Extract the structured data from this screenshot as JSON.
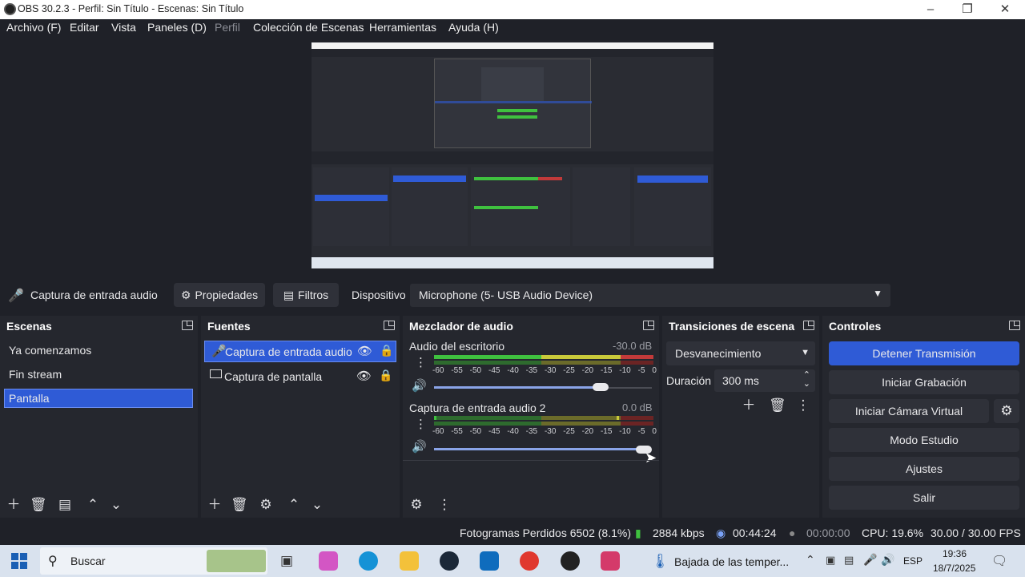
{
  "window": {
    "title": "OBS 30.2.3 - Perfil: Sin Título - Escenas: Sin Título"
  },
  "menu": [
    "Archivo (F)",
    "Editar",
    "Vista",
    "Paneles (D)",
    "Perfil",
    "Colección de Escenas",
    "Herramientas",
    "Ayuda (H)"
  ],
  "source_toolbar": {
    "source_name": "Captura de entrada audio",
    "properties": "Propiedades",
    "filters": "Filtros",
    "device_label": "Dispositivo",
    "device_value": "Microphone (5- USB Audio Device)"
  },
  "scenes": {
    "title": "Escenas",
    "items": [
      "Ya comenzamos",
      "Fin stream",
      "Pantalla"
    ],
    "selected": 2
  },
  "sources": {
    "title": "Fuentes",
    "items": [
      "Captura de entrada audio",
      "Captura de pantalla"
    ]
  },
  "mixer": {
    "title": "Mezclador de audio",
    "channels": [
      {
        "name": "Audio del escritorio",
        "db": "-30.0 dB",
        "volume_fraction": 0.8
      },
      {
        "name": "Captura de entrada audio 2",
        "db": "0.0 dB",
        "volume_fraction": 1.0
      }
    ],
    "ticks": [
      "-60",
      "-55",
      "-50",
      "-45",
      "-40",
      "-35",
      "-30",
      "-25",
      "-20",
      "-15",
      "-10",
      "-5",
      "0"
    ]
  },
  "transitions": {
    "title": "Transiciones de escena",
    "type": "Desvanecimiento",
    "duration_label": "Duración",
    "duration_value": "300 ms"
  },
  "controls": {
    "title": "Controles",
    "buttons": [
      "Detener Transmisión",
      "Iniciar Grabación",
      "Iniciar Cámara Virtual",
      "Modo Estudio",
      "Ajustes",
      "Salir"
    ]
  },
  "status": {
    "dropped": "Fotogramas Perdidos 6502 (8.1%)",
    "bitrate": "2884 kbps",
    "stream_time": "00:44:24",
    "rec_time": "00:00:00",
    "cpu": "CPU: 19.6%",
    "fps": "30.00 / 30.00 FPS"
  },
  "taskbar": {
    "search": "Buscar",
    "weather": "Bajada de las temper...",
    "lang": "ESP",
    "time": "19:36",
    "date": "18/7/2025"
  },
  "colors": {
    "accent": "#2f5bd6",
    "meter_green": "#3fc13f",
    "meter_yellow": "#c9c93a",
    "meter_red": "#c23a3a"
  }
}
